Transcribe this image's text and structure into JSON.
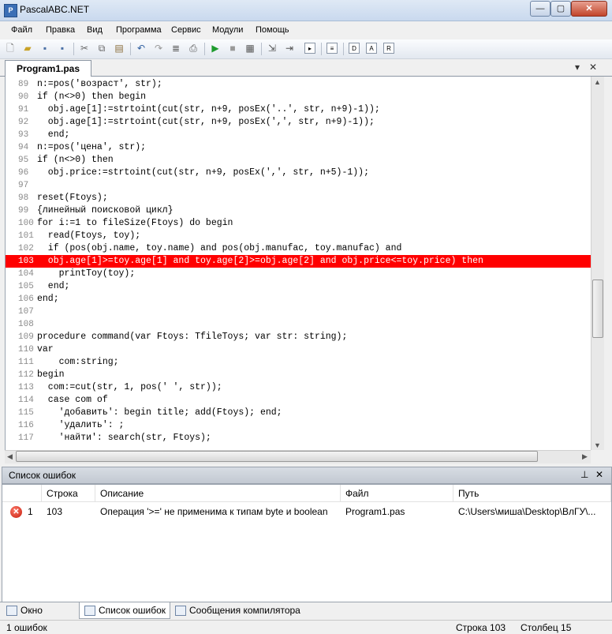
{
  "window": {
    "title": "PascalABC.NET",
    "icon": "pascal-app-icon"
  },
  "menu": [
    "Файл",
    "Правка",
    "Вид",
    "Программа",
    "Сервис",
    "Модули",
    "Помощь"
  ],
  "toolbar_icons": [
    "new-file-icon",
    "open-folder-icon",
    "save-icon",
    "save-all-icon",
    "cut-icon",
    "copy-icon",
    "paste-icon",
    "undo-icon",
    "redo-icon",
    "format-icon",
    "print-icon",
    "run-icon",
    "stop-icon",
    "compile-icon",
    "step-into-icon",
    "step-over-icon",
    "console-icon",
    "debug-icon",
    "form-icon",
    "tool-a-icon",
    "tool-b-icon"
  ],
  "editor_tab": {
    "label": "Program1.pas"
  },
  "code_lines": [
    {
      "n": "89",
      "text": "n:=pos('возраст', str);",
      "highlight": false
    },
    {
      "n": "90",
      "text": "if (n<>0) then begin",
      "highlight": false
    },
    {
      "n": "91",
      "text": "  obj.age[1]:=strtoint(cut(str, n+9, posEx('..', str, n+9)-1));",
      "highlight": false
    },
    {
      "n": "92",
      "text": "  obj.age[1]:=strtoint(cut(str, n+9, posEx(',', str, n+9)-1));",
      "highlight": false
    },
    {
      "n": "93",
      "text": "  end;",
      "highlight": false
    },
    {
      "n": "94",
      "text": "n:=pos('цена', str);",
      "highlight": false
    },
    {
      "n": "95",
      "text": "if (n<>0) then",
      "highlight": false
    },
    {
      "n": "96",
      "text": "  obj.price:=strtoint(cut(str, n+9, posEx(',', str, n+5)-1));",
      "highlight": false
    },
    {
      "n": "97",
      "text": "",
      "highlight": false
    },
    {
      "n": "98",
      "text": "reset(Ftoys);",
      "highlight": false
    },
    {
      "n": "99",
      "text": "{линейный поисковой цикл}",
      "highlight": false
    },
    {
      "n": "100",
      "text": "for i:=1 to fileSize(Ftoys) do begin",
      "highlight": false
    },
    {
      "n": "101",
      "text": "  read(Ftoys, toy);",
      "highlight": false
    },
    {
      "n": "102",
      "text": "  if (pos(obj.name, toy.name) and pos(obj.manufac, toy.manufac) and",
      "highlight": false
    },
    {
      "n": "103",
      "text": "  obj.age[1]>=toy.age[1] and toy.age[2]>=obj.age[2] and obj.price<=toy.price) then",
      "highlight": true
    },
    {
      "n": "104",
      "text": "    printToy(toy);",
      "highlight": false
    },
    {
      "n": "105",
      "text": "  end;",
      "highlight": false
    },
    {
      "n": "106",
      "text": "end;",
      "highlight": false
    },
    {
      "n": "107",
      "text": "",
      "highlight": false
    },
    {
      "n": "108",
      "text": "",
      "highlight": false
    },
    {
      "n": "109",
      "text": "procedure command(var Ftoys: TfileToys; var str: string);",
      "highlight": false
    },
    {
      "n": "110",
      "text": "var",
      "highlight": false
    },
    {
      "n": "111",
      "text": "    com:string;",
      "highlight": false
    },
    {
      "n": "112",
      "text": "begin",
      "highlight": false
    },
    {
      "n": "113",
      "text": "  com:=cut(str, 1, pos(' ', str));",
      "highlight": false
    },
    {
      "n": "114",
      "text": "  case com of",
      "highlight": false
    },
    {
      "n": "115",
      "text": "    'добавить': begin title; add(Ftoys); end;",
      "highlight": false
    },
    {
      "n": "116",
      "text": "    'удалить': ;",
      "highlight": false
    },
    {
      "n": "117",
      "text": "    'найти': search(str, Ftoys);",
      "highlight": false
    }
  ],
  "errors_panel": {
    "title": "Список ошибок",
    "columns": [
      "Строка",
      "Описание",
      "Файл",
      "Путь"
    ],
    "rows": [
      {
        "index": "1",
        "line": "103",
        "description": "Операция '>=' не применима к типам byte и boolean",
        "file": "Program1.pas",
        "path": "C:\\Users\\миша\\Desktop\\ВлГУ\\..."
      }
    ]
  },
  "bottom_tabs": [
    "Окно вывода",
    "Список ошибок",
    "Сообщения компилятора"
  ],
  "status": {
    "errors": "1 ошибок",
    "line": "Строка 103",
    "column": "Столбец 15"
  }
}
